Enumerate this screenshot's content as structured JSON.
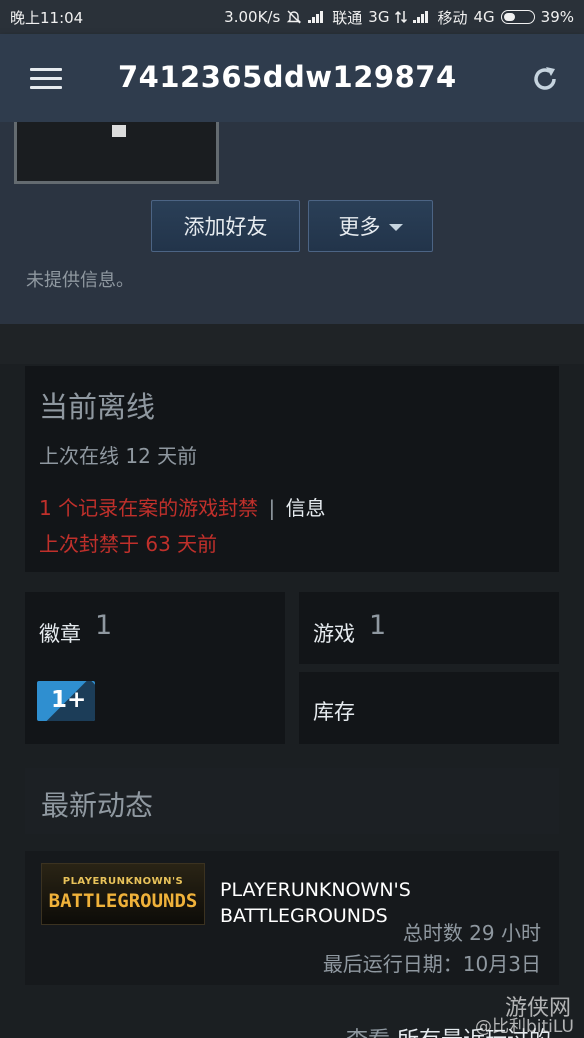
{
  "status_bar": {
    "time": "晚上11:04",
    "speed": "3.00K/s",
    "carrier1": "联通",
    "net1": "3G",
    "carrier2": "移动",
    "net2": "4G",
    "battery": "39%"
  },
  "appbar": {
    "title": "7412365ddw129874"
  },
  "profile": {
    "add_friend_label": "添加好友",
    "more_label": "更多",
    "no_info": "未提供信息。"
  },
  "status": {
    "title": "当前离线",
    "last_online": "上次在线 12 天前",
    "ban_text": "1 个记录在案的游戏封禁",
    "separator": "|",
    "info_link": "信息",
    "ban_date": "上次封禁于 63 天前"
  },
  "badges": {
    "label": "徽章",
    "count": "1",
    "badge_text": "1+"
  },
  "games": {
    "label": "游戏",
    "count": "1"
  },
  "inventory": {
    "label": "库存"
  },
  "activity": {
    "title": "最新动态",
    "game": {
      "logo_top": "PLAYERUNKNOWN'S",
      "logo_main": "BATTLEGROUNDS",
      "name_line1": "PLAYERUNKNOWN'S",
      "name_line2": "BATTLEGROUNDS",
      "hours": "总时数 29 小时",
      "last_played": "最后运行日期：10月3日"
    }
  },
  "footer": {
    "view_prefix": "查看",
    "view_link": "所有最近玩过的"
  },
  "watermark": {
    "site": "游侠网",
    "handle": "@比利bitiLU"
  }
}
